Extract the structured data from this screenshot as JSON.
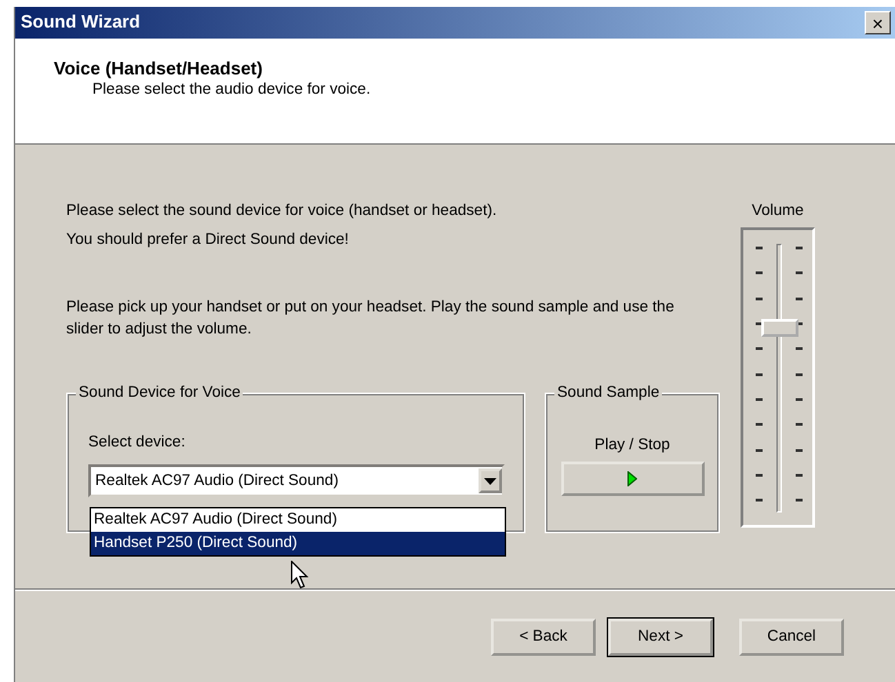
{
  "window": {
    "title": "Sound Wizard",
    "close": "×"
  },
  "header": {
    "title": "Voice (Handset/Headset)",
    "subtitle": "Please select the audio device for voice."
  },
  "intro": [
    "Please select the sound device for voice (handset or headset).",
    "You should prefer a Direct Sound device!"
  ],
  "instructions": "Please pick up your handset or put on your headset. Play the sound sample and use the slider to adjust the volume.",
  "volume": {
    "label": "Volume",
    "level": 0.69
  },
  "device_group": {
    "legend": "Sound Device for Voice",
    "label": "Select device:",
    "value": "Realtek AC97 Audio (Direct Sound)",
    "expanded": true,
    "options": [
      {
        "label": "Realtek AC97 Audio (Direct Sound)",
        "highlighted": false
      },
      {
        "label": "Handset P250 (Direct Sound)",
        "highlighted": true
      }
    ]
  },
  "sample_group": {
    "legend": "Sound Sample",
    "label": "Play / Stop"
  },
  "buttons": [
    {
      "label": "< Back",
      "default": false
    },
    {
      "label": "Next >",
      "default": true
    },
    {
      "label": "Cancel",
      "default": false
    }
  ]
}
